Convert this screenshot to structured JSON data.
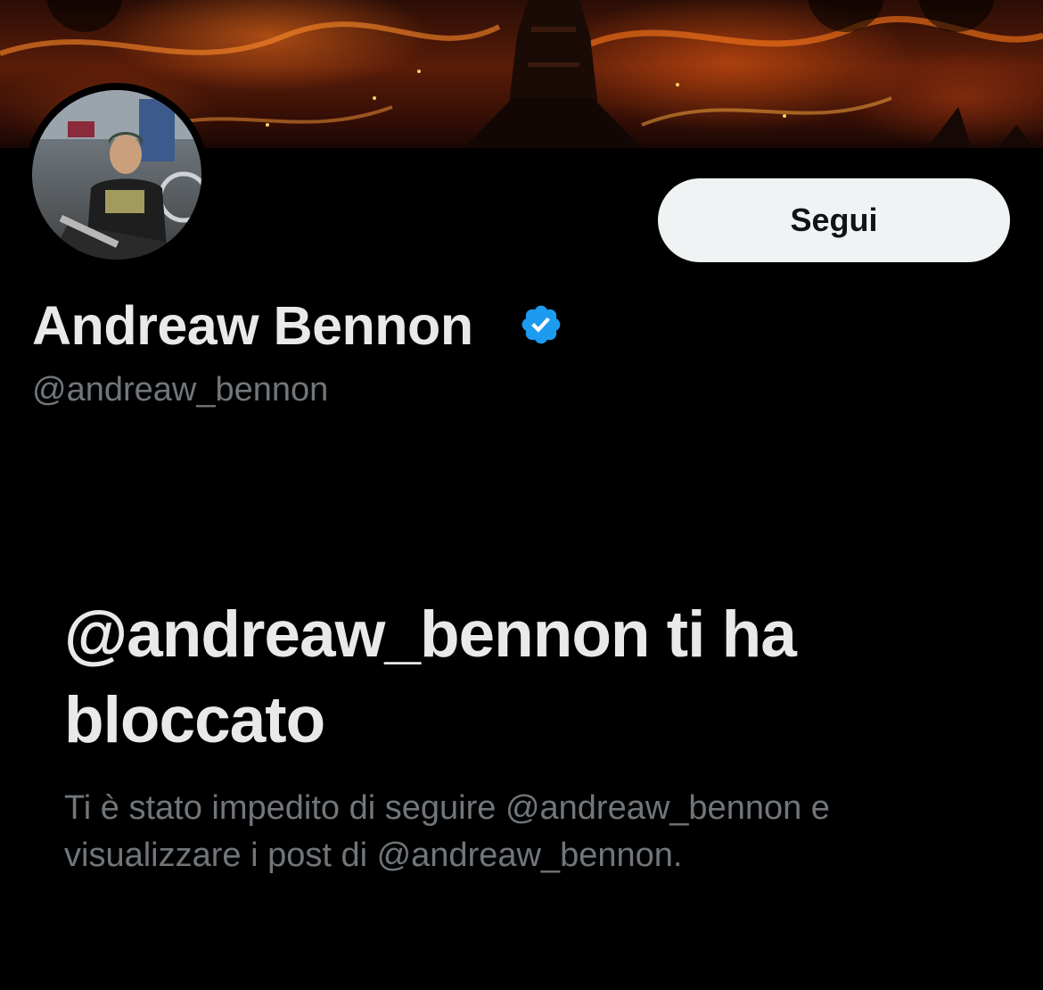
{
  "profile": {
    "display_name": "Andreaw Bennon",
    "handle": "@andreaw_bennon",
    "verified": true,
    "verified_color": "#1d9bf0",
    "avatar_icon": "profile-photo",
    "banner_icon": "fiery-tower-banner"
  },
  "actions": {
    "follow_label": "Segui"
  },
  "blocked": {
    "title": "@andreaw_bennon ti ha bloccato",
    "description": "Ti è stato impedito di seguire @andreaw_bennon e visualizzare i post di @andreaw_bennon."
  },
  "colors": {
    "background": "#000000",
    "primary_text": "#e7e9ea",
    "secondary_text": "#71767b",
    "button_bg": "#eff3f4"
  }
}
